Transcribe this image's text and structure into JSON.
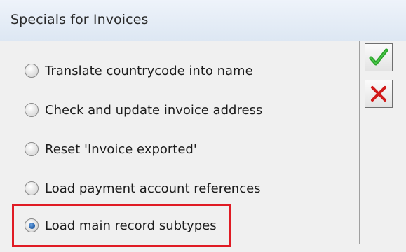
{
  "window": {
    "title": "Specials for Invoices"
  },
  "options": [
    {
      "label": "Translate countrycode into name",
      "selected": false
    },
    {
      "label": "Check and update invoice address",
      "selected": false
    },
    {
      "label": "Reset 'Invoice exported'",
      "selected": false
    },
    {
      "label": "Load payment account references",
      "selected": false
    },
    {
      "label": "Load main record subtypes",
      "selected": true
    }
  ],
  "buttons": {
    "ok_icon": "checkmark-icon",
    "cancel_icon": "x-icon"
  },
  "colors": {
    "highlight": "#e01b24",
    "ok_green": "#27a327",
    "cancel_red": "#d11a1a",
    "radio_selected": "#245fa8"
  }
}
